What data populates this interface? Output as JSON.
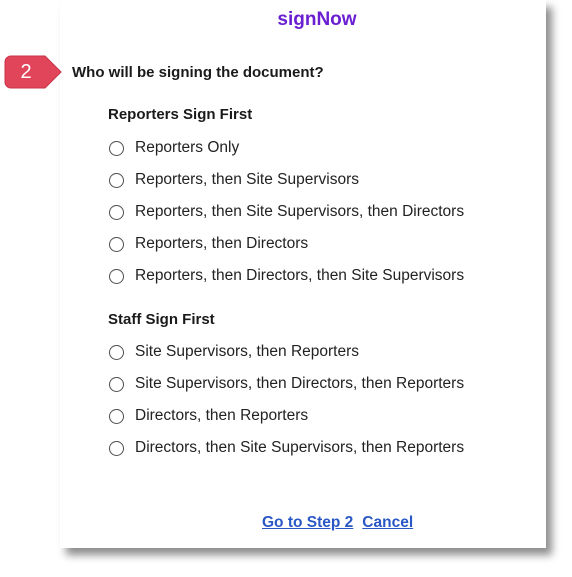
{
  "brand": "signNow",
  "step": {
    "number": "2",
    "question": "Who will be signing the document?"
  },
  "groups": [
    {
      "heading": "Reporters Sign First",
      "options": [
        "Reporters Only",
        "Reporters, then Site Supervisors",
        "Reporters, then Site Supervisors, then Directors",
        "Reporters, then Directors",
        "Reporters, then Directors, then Site Supervisors"
      ]
    },
    {
      "heading": "Staff Sign First",
      "options": [
        "Site Supervisors, then Reporters",
        "Site Supervisors, then Directors, then Reporters",
        "Directors, then Reporters",
        "Directors, then Site Supervisors, then Reporters"
      ]
    }
  ],
  "actions": {
    "next_label": "Go to Step 2",
    "cancel_label": "Cancel"
  },
  "colors": {
    "brand": "#6a1fd1",
    "badge": "#e0455a",
    "link": "#2a57c6"
  }
}
